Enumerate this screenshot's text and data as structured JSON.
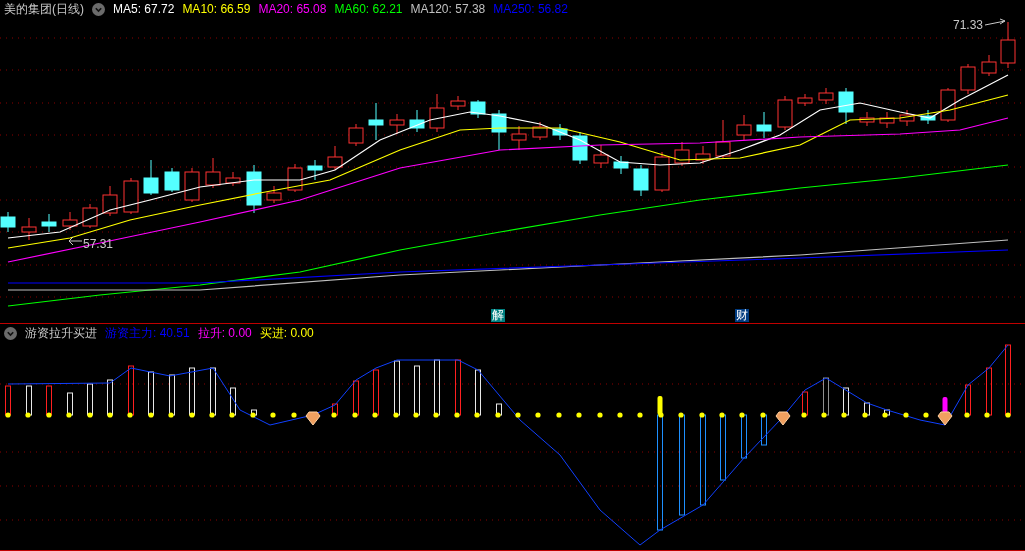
{
  "main_panel": {
    "title": "美的集团(日线)",
    "averages": [
      {
        "label": "MA5: 67.72",
        "color": "#ffffff"
      },
      {
        "label": "MA10: 66.59",
        "color": "#ffff00"
      },
      {
        "label": "MA20: 65.08",
        "color": "#ff00ff"
      },
      {
        "label": "MA60: 62.21",
        "color": "#00ff00"
      },
      {
        "label": "MA120: 57.38",
        "color": "#c0c0c0"
      },
      {
        "label": "MA250: 56.82",
        "color": "#0000ff"
      }
    ],
    "high_label": "71.33",
    "low_label": "57.31",
    "markers": [
      {
        "text": "解",
        "color": "#008080"
      },
      {
        "text": "财",
        "color": "#003b80"
      }
    ]
  },
  "indicator_panel": {
    "title": "游资拉升买进",
    "values": [
      {
        "label": "游资主力: 40.51",
        "color": "#0000ff"
      },
      {
        "label": "拉升: 0.00",
        "color": "#ff00ff"
      },
      {
        "label": "买进: 0.00",
        "color": "#ffff00"
      }
    ]
  }
}
